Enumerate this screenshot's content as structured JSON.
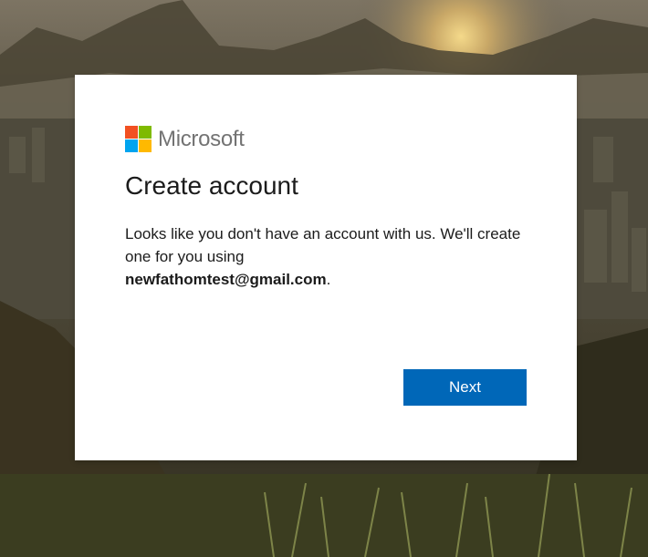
{
  "brand": {
    "name": "Microsoft",
    "logo_colors": [
      "#f25022",
      "#7fba00",
      "#00a4ef",
      "#ffb900"
    ]
  },
  "dialog": {
    "title": "Create account",
    "message_prefix": "Looks like you don't have an account with us. We'll create one for you using",
    "email": "newfathomtest@gmail.com",
    "message_suffix": ".",
    "next_label": "Next"
  },
  "colors": {
    "primary_button": "#0067b8",
    "background_image": "sunset-mountain-city-photo"
  }
}
